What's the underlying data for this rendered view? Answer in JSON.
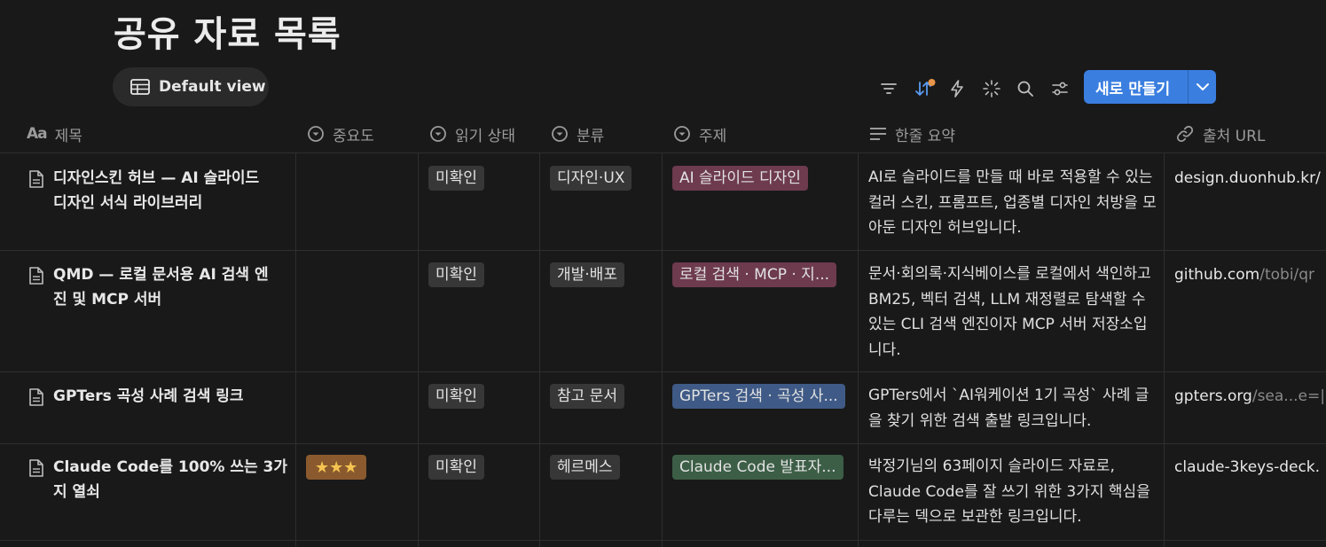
{
  "page": {
    "title": "공유 자료 목록"
  },
  "view": {
    "label": "Default view"
  },
  "toolbar": {
    "new_label": "새로 만들기"
  },
  "columns": [
    {
      "label": "제목",
      "icon": "title-text-icon"
    },
    {
      "label": "중요도",
      "icon": "select-icon"
    },
    {
      "label": "읽기 상태",
      "icon": "select-icon"
    },
    {
      "label": "분류",
      "icon": "select-icon"
    },
    {
      "label": "주제",
      "icon": "select-icon"
    },
    {
      "label": "한줄 요약",
      "icon": "text-lines-icon"
    },
    {
      "label": "출처 URL",
      "icon": "link-icon"
    }
  ],
  "rows": [
    {
      "title_line1": "디자인스킨 허브 — AI 슬라이드",
      "title_line2": "디자인 서식 라이브러리",
      "importance": "",
      "status": "미확인",
      "category": "디자인·UX",
      "topic": "AI 슬라이드 디자인",
      "topic_color": "#6d3a4e",
      "summary": "AI로 슬라이드를 만들 때 바로 적용할 수 있는 컬러 스킨, 프롬프트, 업종별 디자인 처방을 모아둔 디자인 허브입니다.",
      "url_main": "design.duonhub.kr/",
      "url_dim": ""
    },
    {
      "title_line1": "QMD — 로컬 문서용 AI 검색 엔",
      "title_line2": "진 및 MCP 서버",
      "importance": "",
      "status": "미확인",
      "category": "개발·배포",
      "topic": "로컬 검색 · MCP · 지...",
      "topic_color": "#6d3a4e",
      "summary": "문서·회의록·지식베이스를 로컬에서 색인하고 BM25, 벡터 검색, LLM 재정렬로 탐색할 수 있는 CLI 검색 엔진이자 MCP 서버 저장소입니다.",
      "url_main": "github.com",
      "url_dim": "/tobi/qr"
    },
    {
      "title_line1": "GPTers 곡성 사례 검색 링크",
      "title_line2": "",
      "importance": "",
      "status": "미확인",
      "category": "참고 문서",
      "topic": "GPTers 검색 · 곡성 사...",
      "topic_color": "#3f5a86",
      "summary": "GPTers에서 `AI워케이션 1기 곡성` 사례 글을 찾기 위한 검색 출발 링크입니다.",
      "url_main": "gpters.org",
      "url_dim": "/sea...e=|"
    },
    {
      "title_line1": "Claude Code를 100% 쓰는 3가",
      "title_line2": "지 열쇠",
      "importance": "★★★",
      "status": "미확인",
      "category": "헤르메스",
      "topic": "Claude Code 발표자...",
      "topic_color": "#3c5e46",
      "summary": "박정기님의 63페이지 슬라이드 자료로, Claude Code를 잘 쓰기 위한 3가지 핵심을 다루는 덱으로 보관한 링크입니다.",
      "url_main": "claude-3keys-deck.",
      "url_dim": ""
    }
  ]
}
